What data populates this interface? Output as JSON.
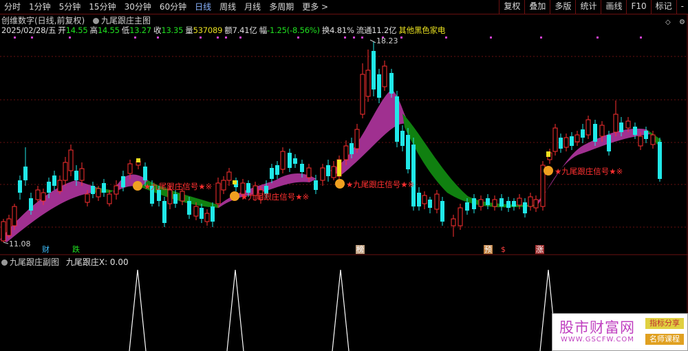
{
  "toolbar": {
    "periods": [
      "分时",
      "1分钟",
      "5分钟",
      "15分钟",
      "30分钟",
      "60分钟",
      "日线",
      "周线",
      "月线",
      "多周期",
      "更多 >"
    ],
    "active_period": "日线",
    "right_buttons": [
      "复权",
      "叠加",
      "多版",
      "统计",
      "画线",
      "F10",
      "标记",
      "-"
    ]
  },
  "header": {
    "stock_name": "创维数字(日线,前复权)",
    "main_indicator": "九尾跟庄主图"
  },
  "quote": {
    "date": "2025/02/28/五",
    "open_label": "开",
    "open": "14.55",
    "high_label": "高",
    "high": "14.55",
    "low_label": "低",
    "low": "13.27",
    "close_label": "收",
    "close": "13.35",
    "volume_label": "量",
    "volume": "537089",
    "amount_label": "额",
    "amount": "7.41亿",
    "change_label": "幅",
    "change": "-1.25(-8.56%)",
    "turnover_label": "换",
    "turnover": "4.81%",
    "float_label": "流通",
    "float": "11.2亿",
    "sector": "其他黑色家电"
  },
  "chart_labels": {
    "high_price": "18.23",
    "low_price": "11.08",
    "signal_text": "★九尾跟庄信号★※",
    "tags": [
      "财",
      "跌",
      "榜",
      "预",
      "$",
      "涨"
    ]
  },
  "sub_chart": {
    "title": "九尾跟庄副图",
    "value_label": "九尾跟庄X: 0.00"
  },
  "watermark": {
    "title": "股市财富网",
    "url": "WWW.GSCFW.COM",
    "badge1": "指标分享",
    "badge2": "名师课程"
  },
  "colors": {
    "up": "#ff3030",
    "down": "#20e8e8",
    "band_up": "#a03090",
    "band_down": "#108010",
    "bg": "#000000"
  },
  "chart_data": {
    "type": "candlestick",
    "ylim": [
      11.08,
      18.23
    ],
    "candles": [
      {
        "o": 11.3,
        "h": 12.0,
        "l": 11.1,
        "c": 11.9
      },
      {
        "o": 12.3,
        "h": 12.6,
        "l": 11.7,
        "c": 11.9
      },
      {
        "o": 13.4,
        "h": 13.9,
        "l": 13.0,
        "c": 13.8
      },
      {
        "o": 12.9,
        "h": 13.2,
        "l": 12.6,
        "c": 13.0
      },
      {
        "o": 12.5,
        "h": 12.8,
        "l": 12.2,
        "c": 12.7
      },
      {
        "o": 12.9,
        "h": 13.2,
        "l": 12.7,
        "c": 13.1
      },
      {
        "o": 12.9,
        "h": 13.1,
        "l": 12.6,
        "c": 12.7
      },
      {
        "o": 12.5,
        "h": 12.7,
        "l": 12.2,
        "c": 12.6
      },
      {
        "o": 13.3,
        "h": 13.6,
        "l": 13.1,
        "c": 13.5
      },
      {
        "o": 13.0,
        "h": 13.3,
        "l": 12.8,
        "c": 13.1
      },
      {
        "o": 12.7,
        "h": 12.9,
        "l": 12.3,
        "c": 12.5
      },
      {
        "o": 12.3,
        "h": 12.5,
        "l": 12.0,
        "c": 12.4
      },
      {
        "o": 12.6,
        "h": 12.8,
        "l": 12.5,
        "c": 12.7
      }
    ]
  }
}
